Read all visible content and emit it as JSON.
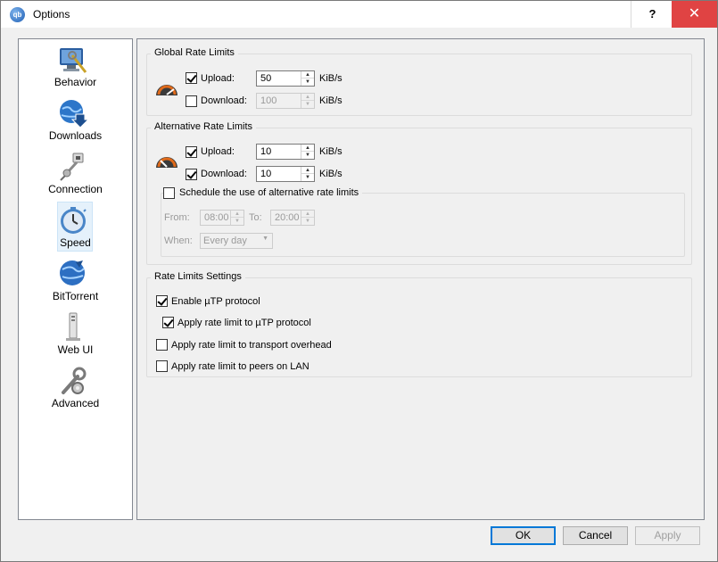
{
  "window": {
    "title": "Options",
    "help_label": "?",
    "close_label": "✕"
  },
  "sidebar": {
    "items": [
      {
        "label": "Behavior",
        "icon": "behavior-icon"
      },
      {
        "label": "Downloads",
        "icon": "downloads-icon"
      },
      {
        "label": "Connection",
        "icon": "connection-icon"
      },
      {
        "label": "Speed",
        "icon": "speed-icon",
        "selected": true
      },
      {
        "label": "BitTorrent",
        "icon": "bittorrent-icon"
      },
      {
        "label": "Web UI",
        "icon": "webui-icon"
      },
      {
        "label": "Advanced",
        "icon": "advanced-icon"
      }
    ]
  },
  "global": {
    "title": "Global Rate Limits",
    "upload_label": "Upload:",
    "upload_value": "50",
    "upload_unit": "KiB/s",
    "upload_checked": true,
    "download_label": "Download:",
    "download_value": "100",
    "download_unit": "KiB/s",
    "download_checked": false
  },
  "alternative": {
    "title": "Alternative Rate Limits",
    "upload_label": "Upload:",
    "upload_value": "10",
    "upload_unit": "KiB/s",
    "upload_checked": true,
    "download_label": "Download:",
    "download_value": "10",
    "download_unit": "KiB/s",
    "download_checked": true,
    "schedule_label": "Schedule the use of alternative rate limits",
    "schedule_checked": false,
    "from_label": "From:",
    "from_value": "08:00",
    "to_label": "To:",
    "to_value": "20:00",
    "when_label": "When:",
    "when_value": "Every day"
  },
  "settings": {
    "title": "Rate Limits Settings",
    "utp_label": "Enable µTP protocol",
    "utp_checked": true,
    "utp_limit_label": "Apply rate limit to µTP protocol",
    "utp_limit_checked": true,
    "overhead_label": "Apply rate limit to transport overhead",
    "overhead_checked": false,
    "lan_label": "Apply rate limit to peers on LAN",
    "lan_checked": false
  },
  "buttons": {
    "ok": "OK",
    "cancel": "Cancel",
    "apply": "Apply"
  },
  "colors": {
    "accent": "#0078d7",
    "close": "#e04343"
  }
}
